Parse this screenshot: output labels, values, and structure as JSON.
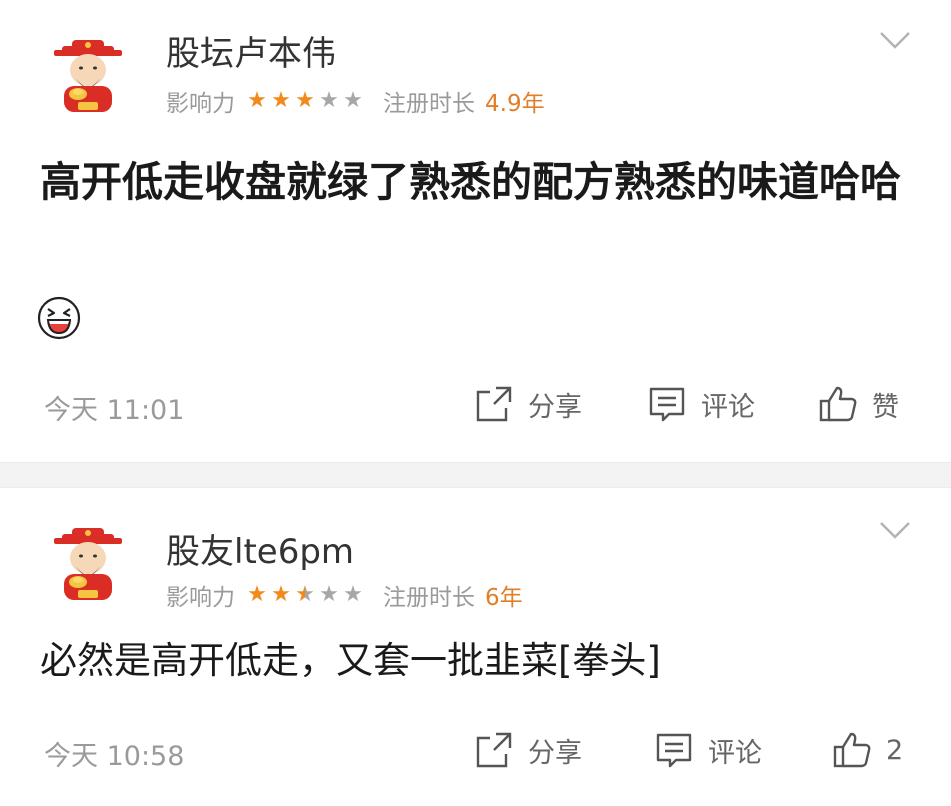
{
  "posts": [
    {
      "username": "股坛卢本伟",
      "influence_label": "影响力",
      "rating": {
        "full": 3,
        "half": 0,
        "empty": 2
      },
      "registration_label": "注册时长",
      "registration_value": "4.9年",
      "content": "高开低走收盘就绿了熟悉的配方熟悉的味道哈哈",
      "time": "今天 11:01",
      "share_label": "分享",
      "comment_label": "评论",
      "like_label": "赞"
    },
    {
      "username": "股友lte6pm",
      "influence_label": "影响力",
      "rating": {
        "full": 2,
        "half": 1,
        "empty": 2
      },
      "registration_label": "注册时长",
      "registration_value": "6年",
      "content": "必然是高开低走，又套一批韭菜[拳头]",
      "time": "今天 10:58",
      "share_label": "分享",
      "comment_label": "评论",
      "like_label": "2"
    }
  ],
  "colors": {
    "star_active": "#f28a1b",
    "star_inactive": "#a7a7a7",
    "registration_value": "#e07f2a",
    "meta_text": "#9a9a9a",
    "separator": "#f3f3f3"
  },
  "icons": [
    "god-of-wealth-avatar",
    "chevron-down-icon",
    "laughing-emoji-icon",
    "share-icon",
    "comment-icon",
    "thumbs-up-icon"
  ]
}
